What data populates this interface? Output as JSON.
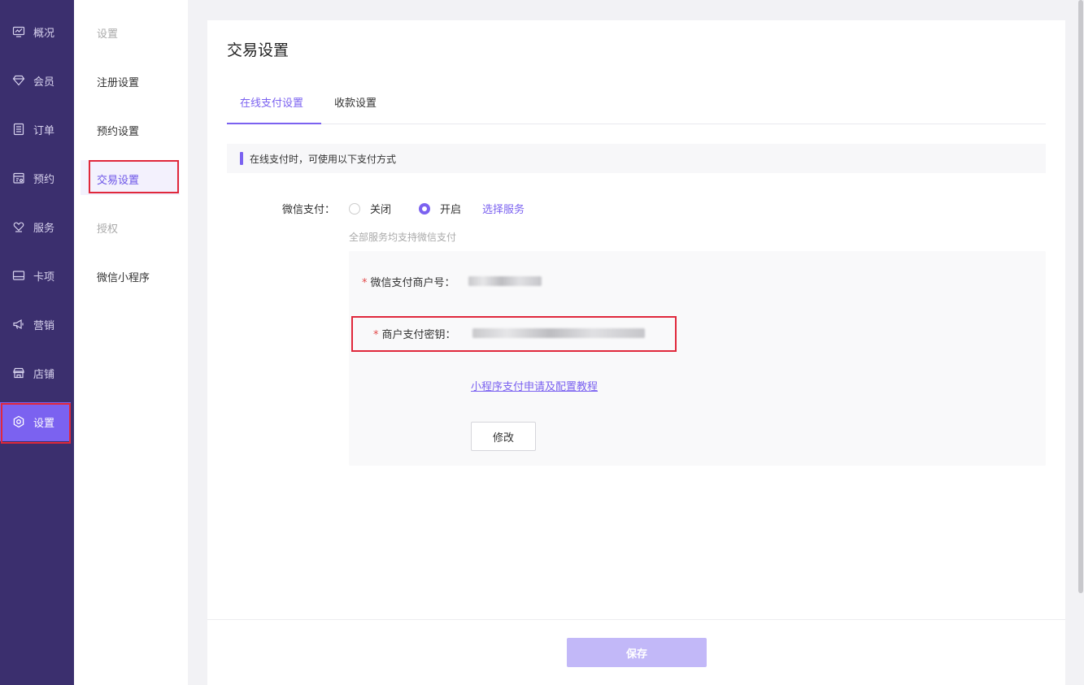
{
  "nav": {
    "items": [
      {
        "label": "概况",
        "icon": "monitor-icon"
      },
      {
        "label": "会员",
        "icon": "diamond-icon"
      },
      {
        "label": "订单",
        "icon": "list-icon"
      },
      {
        "label": "预约",
        "icon": "calendar-icon"
      },
      {
        "label": "服务",
        "icon": "heart-hand-icon"
      },
      {
        "label": "卡项",
        "icon": "card-icon"
      },
      {
        "label": "营销",
        "icon": "megaphone-icon"
      },
      {
        "label": "店铺",
        "icon": "store-icon"
      },
      {
        "label": "设置",
        "icon": "settings-icon"
      }
    ],
    "active_index": 8
  },
  "subnav": {
    "items": [
      {
        "label": "设置"
      },
      {
        "label": "注册设置"
      },
      {
        "label": "预约设置"
      },
      {
        "label": "交易设置"
      },
      {
        "label": "授权"
      },
      {
        "label": "微信小程序"
      }
    ],
    "active_index": 3
  },
  "main": {
    "title": "交易设置",
    "tabs": [
      {
        "label": "在线支付设置"
      },
      {
        "label": "收款设置"
      }
    ],
    "active_tab": 0,
    "notice": "在线支付时，可使用以下支付方式",
    "wechat_pay": {
      "label": "微信支付：",
      "options": [
        {
          "label": "关闭",
          "selected": false
        },
        {
          "label": "开启",
          "selected": true
        }
      ],
      "select_service_link": "选择服务",
      "hint": "全部服务均支持微信支付"
    },
    "panel": {
      "merchant_id_label": "微信支付商户号：",
      "merchant_key_label": "商户支付密钥：",
      "required_mark": "*",
      "tutorial_link": "小程序支付申请及配置教程",
      "edit_button": "修改"
    },
    "save_button": "保存"
  },
  "colors": {
    "nav_bg": "#3b2f6e",
    "accent": "#7b62f0",
    "highlight": "#e0283b",
    "save_disabled": "#c2b8f8"
  }
}
